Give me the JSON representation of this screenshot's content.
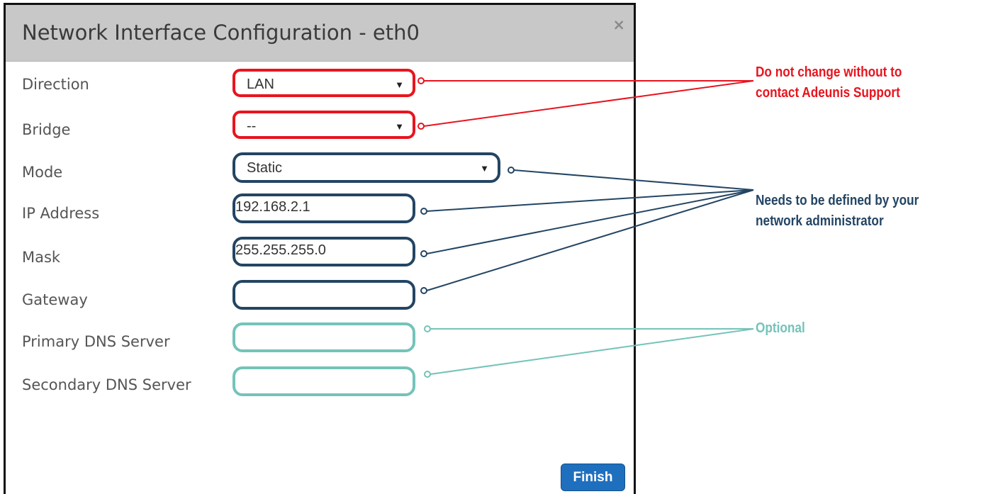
{
  "dialog": {
    "title": "Network Interface Configuration - eth0",
    "close_glyph": "×",
    "finish_label": "Finish"
  },
  "fields": {
    "direction": {
      "label": "Direction",
      "value": "LAN",
      "type": "select"
    },
    "bridge": {
      "label": "Bridge",
      "value": "--",
      "type": "select"
    },
    "mode": {
      "label": "Mode",
      "value": "Static",
      "type": "select"
    },
    "ip_address": {
      "label": "IP Address",
      "value": "192.168.2.1",
      "type": "text"
    },
    "mask": {
      "label": "Mask",
      "value": "255.255.255.0",
      "type": "text"
    },
    "gateway": {
      "label": "Gateway",
      "value": "",
      "type": "text"
    },
    "primary_dns": {
      "label": "Primary DNS Server",
      "value": "",
      "type": "text"
    },
    "secondary_dns": {
      "label": "Secondary DNS Server",
      "value": "",
      "type": "text"
    }
  },
  "select_arrow": "▼",
  "annotations": {
    "red": {
      "line1": "Do not change without to",
      "line2": "contact Adeunis Support",
      "color": "#e8141e"
    },
    "navy": {
      "line1": "Needs to be defined by your",
      "line2": "network administrator",
      "color": "#234564"
    },
    "teal": {
      "line1": "Optional",
      "color": "#74c3b9"
    }
  },
  "colors": {
    "finish_button": "#1f6fbf",
    "titlebar": "#c8c8c8"
  }
}
